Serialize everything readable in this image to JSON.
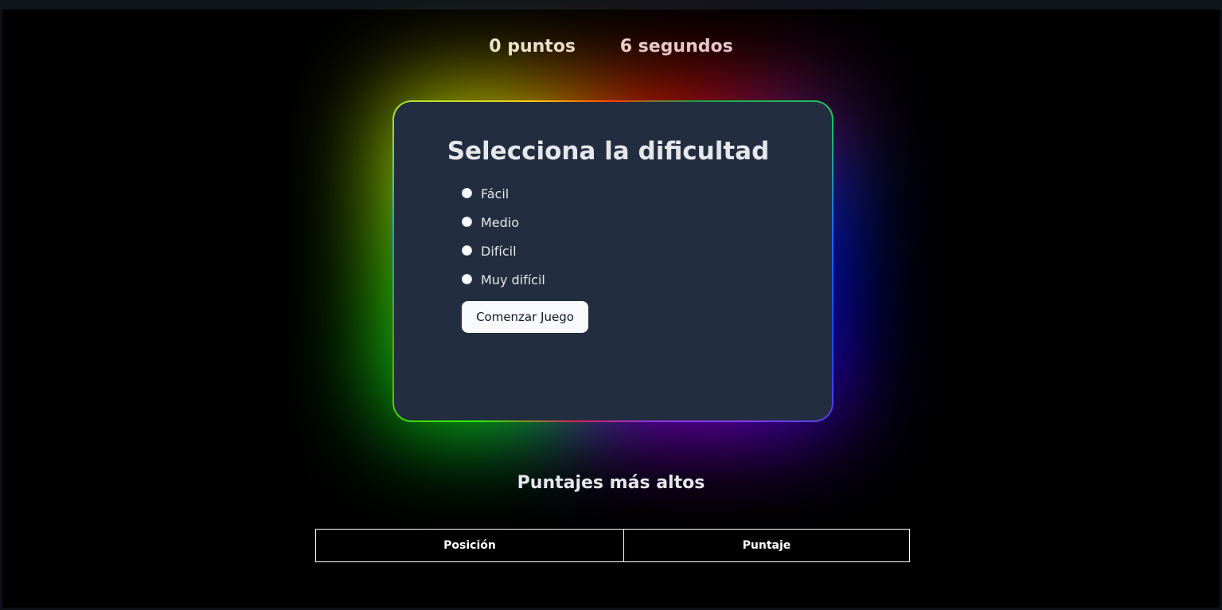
{
  "stats": {
    "points": "0 puntos",
    "seconds": "6 segundos"
  },
  "card": {
    "title": "Selecciona la dificultad",
    "options": [
      "Fácil",
      "Medio",
      "Difícil",
      "Muy difícil"
    ],
    "start_button": "Comenzar Juego"
  },
  "highscores": {
    "title": "Puntajes más altos",
    "columns": [
      "Posición",
      "Puntaje"
    ]
  }
}
